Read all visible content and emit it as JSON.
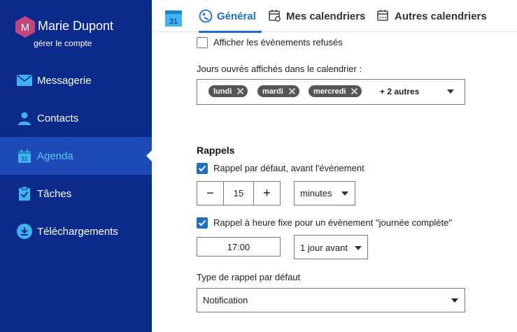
{
  "user": {
    "initial": "M",
    "name": "Marie Dupont",
    "manage_label": "gérer le compte"
  },
  "sidebar": {
    "items": [
      {
        "label": "Messagerie",
        "icon": "mail-icon"
      },
      {
        "label": "Contacts",
        "icon": "contacts-icon"
      },
      {
        "label": "Agenda",
        "icon": "calendar-icon",
        "active": true
      },
      {
        "label": "Tâches",
        "icon": "tasks-icon"
      },
      {
        "label": "Téléchargements",
        "icon": "download-icon"
      }
    ]
  },
  "header": {
    "logo_day": "31",
    "tabs": [
      {
        "label": "Général",
        "active": true,
        "icon": "general-icon"
      },
      {
        "label": "Mes calendriers",
        "icon": "my-calendars-icon"
      },
      {
        "label": "Autres calendriers",
        "icon": "other-calendars-icon"
      }
    ]
  },
  "settings": {
    "show_declined": {
      "label": "Afficher les évènements refusés",
      "checked": false
    },
    "working_days": {
      "label": "Jours ouvrés affichés dans le calendrier :",
      "chips": [
        "lundi",
        "mardi",
        "mercredi"
      ],
      "more": "+ 2 autres"
    },
    "reminders": {
      "title": "Rappels",
      "default_reminder": {
        "label": "Rappel par défaut, avant l'évènement",
        "checked": true
      },
      "stepper": {
        "minus": "−",
        "value": "15",
        "plus": "+"
      },
      "unit_select": {
        "value": "minutes"
      },
      "fixed_time": {
        "label": "Rappel à heure fixe pour un évènement \"journée complète\"",
        "checked": true
      },
      "time_value": "17:00",
      "day_select": {
        "value": "1 jour avant"
      },
      "type_label": "Type de rappel par défaut",
      "type_select": {
        "value": "Notification"
      }
    }
  },
  "colors": {
    "sidebar_bg": "#0b2b8c",
    "sidebar_active_bg": "#1d4ab6",
    "accent": "#1d6fc4",
    "active_nav_text": "#55c7f4",
    "avatar": "#c2457b"
  }
}
